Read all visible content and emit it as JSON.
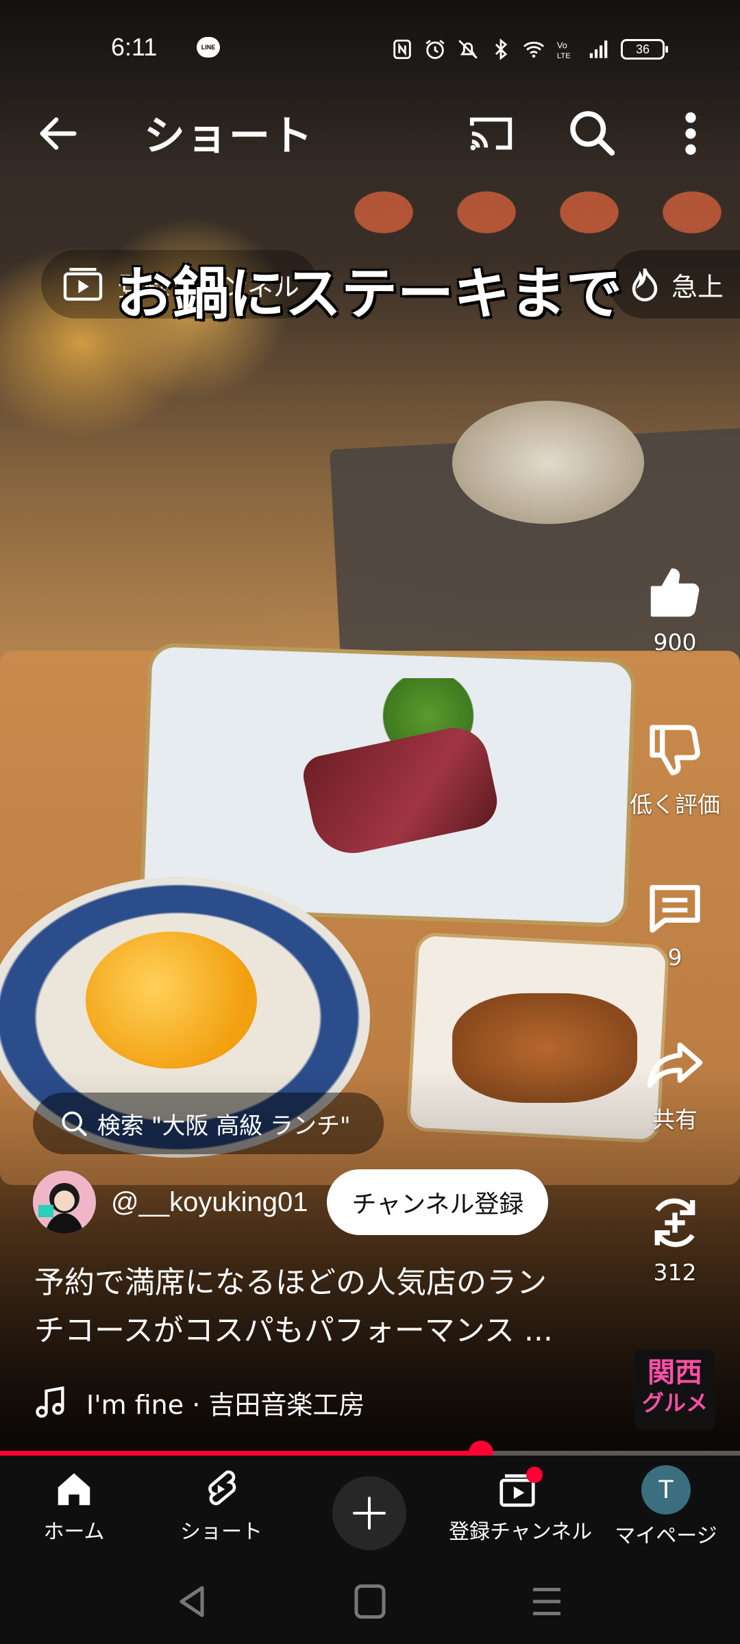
{
  "status_bar": {
    "time": "6:11",
    "line_badge": "LINE",
    "battery": "36",
    "icons": [
      "nfc-icon",
      "alarm-icon",
      "mute-icon",
      "bluetooth-icon",
      "wifi-icon",
      "volte-icon",
      "signal-icon"
    ]
  },
  "header": {
    "title": "ショート",
    "back_icon": "arrow-left-icon",
    "cast_icon": "cast-icon",
    "search_icon": "search-icon",
    "more_icon": "more-vertical-icon"
  },
  "overlay": {
    "left_chip_text": "登録チャンネル",
    "right_chip_text": "急上",
    "caption": "お鍋にステーキまで"
  },
  "actions": {
    "like_count": "900",
    "dislike_label": "低く評価",
    "comment_count": "9",
    "share_label": "共有",
    "remix_count": "312"
  },
  "video_info": {
    "search_suggestion": "検索 \"大阪 高級 ランチ\"",
    "channel_handle": "@__koyuking01",
    "subscribe_label": "チャンネル登録",
    "description_line1": "予約で満席になるほどの人気店のラン",
    "description_line2": "チコースがコスパもパフォーマンス ...",
    "music": "I'm fine · 吉田音楽工房",
    "music_thumb_line1": "関西",
    "music_thumb_line2": "グルメ"
  },
  "progress": {
    "fraction": 0.65
  },
  "bottom_nav": {
    "home": "ホーム",
    "shorts": "ショート",
    "subscriptions": "登録チャンネル",
    "my_page": "マイページ",
    "profile_initial": "T"
  },
  "colors": {
    "accent": "#ff0033",
    "nav_bg": "#0f0f0f"
  }
}
